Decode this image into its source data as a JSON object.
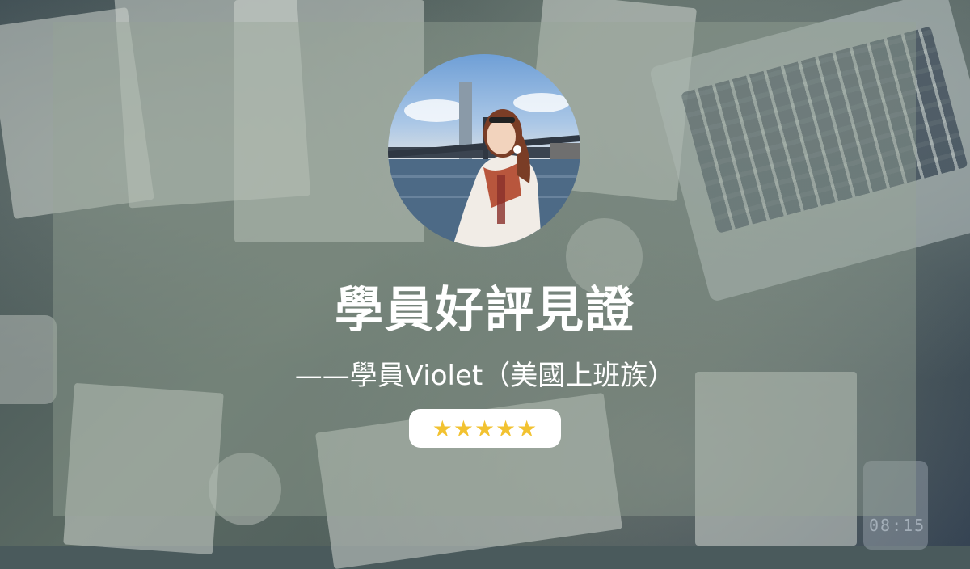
{
  "title": "學員好評見證",
  "subtitle": "——學員Violet（美國上班族）",
  "rating": {
    "stars": "★★★★★",
    "value": 5,
    "max": 5,
    "star_color": "#f2c230"
  },
  "avatar": {
    "icon": "profile-photo"
  },
  "background": {
    "phone_clock": "08:15"
  }
}
